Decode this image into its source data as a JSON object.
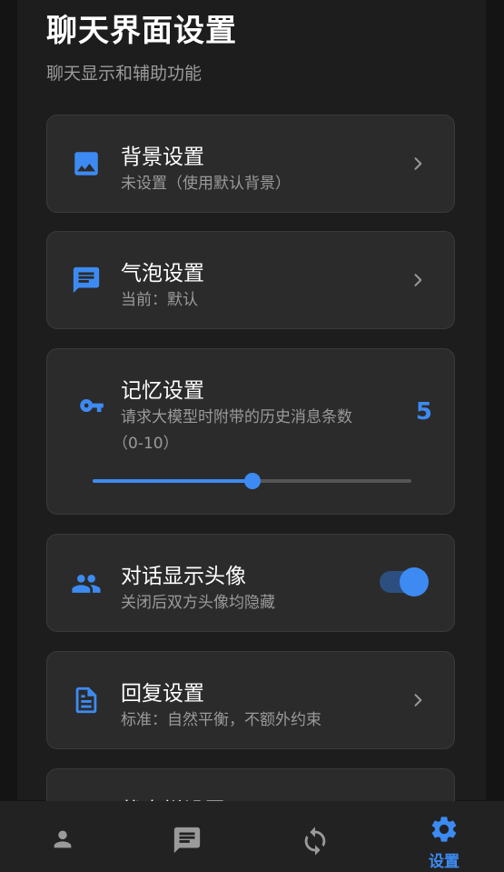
{
  "page": {
    "title": "聊天界面设置",
    "subtitle": "聊天显示和辅助功能"
  },
  "colors": {
    "accent": "#3d8bf2",
    "card_background": "#2b2b2b",
    "page_background": "#141414"
  },
  "cards": {
    "background": {
      "icon": "image-icon",
      "title": "背景设置",
      "subtitle": "未设置（使用默认背景）"
    },
    "bubble": {
      "icon": "message-icon",
      "title": "气泡设置",
      "subtitle": "当前：默认"
    },
    "memory": {
      "icon": "key-icon",
      "title": "记忆设置",
      "subtitle_line1": "请求大模型时附带的历史消息条数",
      "subtitle_line2": "（0-10）",
      "value": "5",
      "slider_value": 5,
      "slider_min": 0,
      "slider_max": 10
    },
    "avatar": {
      "icon": "people-icon",
      "title": "对话显示头像",
      "subtitle": "关闭后双方头像均隐藏",
      "enabled": true
    },
    "reply": {
      "icon": "document-icon",
      "title": "回复设置",
      "subtitle": "标准：自然平衡，不额外约束"
    },
    "status": {
      "title": "状态栏设置"
    }
  },
  "bottom_nav": {
    "items": [
      {
        "icon": "person-icon",
        "label": ""
      },
      {
        "icon": "chat-icon",
        "label": ""
      },
      {
        "icon": "sync-icon",
        "label": ""
      },
      {
        "icon": "gear-icon",
        "label": "设置",
        "active": true
      }
    ]
  }
}
